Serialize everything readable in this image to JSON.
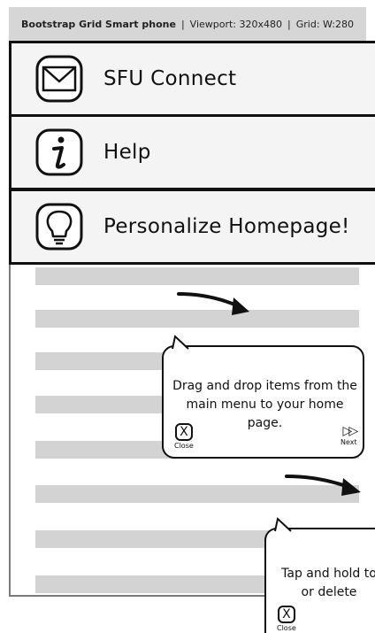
{
  "titlebar": {
    "device": "Bootstrap Grid Smart phone",
    "separator": "|",
    "viewport": "Viewport: 320x480",
    "grid": "Grid: W:280"
  },
  "menu": {
    "items": [
      {
        "label": "SFU Connect",
        "icon": "envelope-icon"
      },
      {
        "label": "Help",
        "icon": "info-icon"
      },
      {
        "label": "Personalize Homepage!",
        "icon": "lightbulb-icon"
      }
    ]
  },
  "tooltips": [
    {
      "text": "Drag and drop items from the main menu to your home page.",
      "close_label": "Close",
      "close_glyph": "X",
      "next_label": "Next",
      "next_icon": "fast-forward-icon"
    },
    {
      "text": "Tap and hold to or delete",
      "close_label": "Close",
      "close_glyph": "X"
    }
  ]
}
